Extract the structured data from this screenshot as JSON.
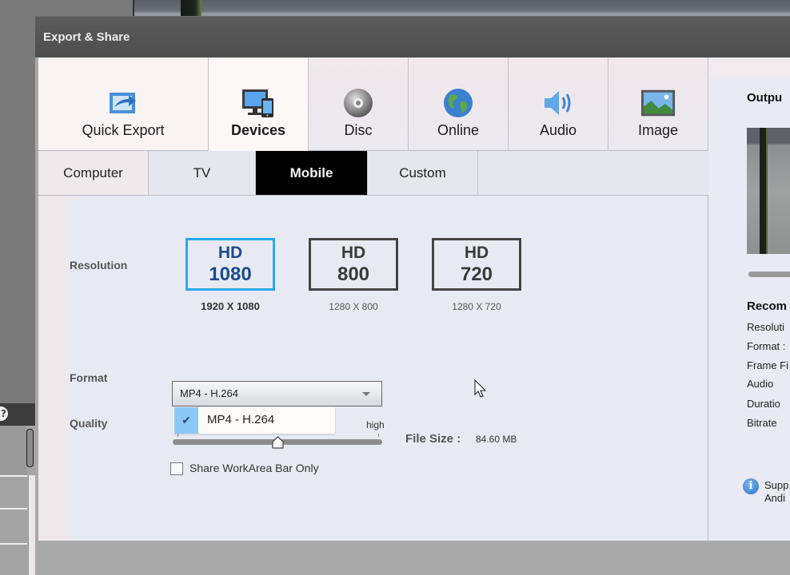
{
  "dialog": {
    "title": "Export & Share"
  },
  "category_tabs": [
    {
      "label": "Quick Export",
      "icon": "quick-export-icon",
      "active": false
    },
    {
      "label": "Devices",
      "icon": "devices-icon",
      "active": true
    },
    {
      "label": "Disc",
      "icon": "disc-icon",
      "active": false
    },
    {
      "label": "Online",
      "icon": "globe-icon",
      "active": false
    },
    {
      "label": "Audio",
      "icon": "speaker-icon",
      "active": false
    },
    {
      "label": "Image",
      "icon": "image-icon",
      "active": false
    }
  ],
  "sub_tabs": [
    {
      "label": "Computer",
      "active": false
    },
    {
      "label": "TV",
      "active": false
    },
    {
      "label": "Mobile",
      "active": true
    },
    {
      "label": "Custom",
      "active": false
    }
  ],
  "resolution": {
    "label": "Resolution",
    "options": [
      {
        "badge_top": "HD",
        "badge_bottom": "1080",
        "caption": "1920 X 1080",
        "selected": true
      },
      {
        "badge_top": "HD",
        "badge_bottom": "800",
        "caption": "1280 X 800",
        "selected": false
      },
      {
        "badge_top": "HD",
        "badge_bottom": "720",
        "caption": "1280 X 720",
        "selected": false
      }
    ]
  },
  "format": {
    "label": "Format",
    "value": "MP4 - H.264",
    "dropdown_options": [
      {
        "label": "MP4 - H.264",
        "checked": true
      }
    ]
  },
  "quality": {
    "label": "Quality",
    "high_label": "high",
    "value_fraction": 0.5
  },
  "file_size": {
    "label": "File Size :",
    "value": "84.60 MB"
  },
  "share_workarea": {
    "label": "Share WorkArea Bar Only",
    "checked": false
  },
  "output_panel": {
    "title": "Outpu",
    "recommended_title": "Recom",
    "rows": [
      "Resoluti",
      "Format :",
      "Frame Fi",
      "Audio",
      "Duratio",
      "Bitrate"
    ],
    "info_lines": [
      "Supp",
      "Andi"
    ]
  },
  "colors": {
    "selected_accent": "#2aa8ee",
    "active_subtab_bg": "#000000",
    "titlebar_bg": "#555555"
  }
}
